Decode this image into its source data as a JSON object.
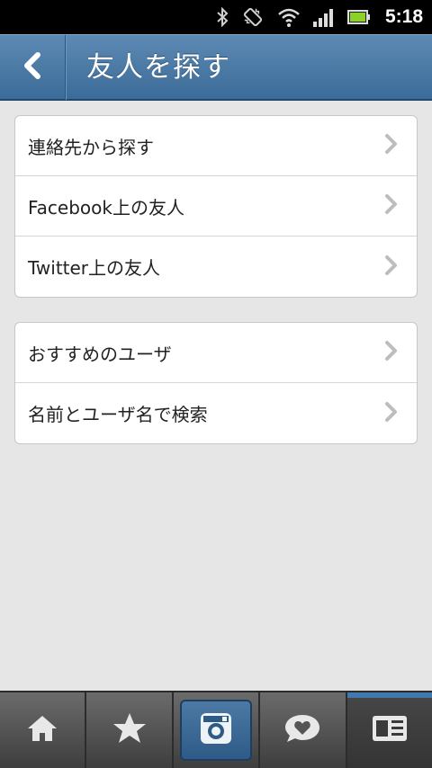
{
  "status_bar": {
    "time": "5:18",
    "icons": [
      "bluetooth-icon",
      "vibrate-icon",
      "wifi-icon",
      "signal-icon",
      "battery-icon"
    ]
  },
  "header": {
    "title": "友人を探す",
    "back_icon": "chevron-left-icon"
  },
  "groups": [
    {
      "items": [
        {
          "label": "連絡先から探す"
        },
        {
          "label": "Facebook上の友人"
        },
        {
          "label": "Twitter上の友人"
        }
      ]
    },
    {
      "items": [
        {
          "label": "おすすめのユーザ"
        },
        {
          "label": "名前とユーザ名で検索"
        }
      ]
    }
  ],
  "tab_bar": {
    "tabs": [
      {
        "icon": "home-icon"
      },
      {
        "icon": "star-icon"
      },
      {
        "icon": "camera-icon"
      },
      {
        "icon": "comment-heart-icon"
      },
      {
        "icon": "news-icon",
        "active": true
      }
    ]
  },
  "colors": {
    "header": "#4a79a6",
    "background": "#e6e6e6",
    "tab_active_highlight": "#3f79ae"
  }
}
